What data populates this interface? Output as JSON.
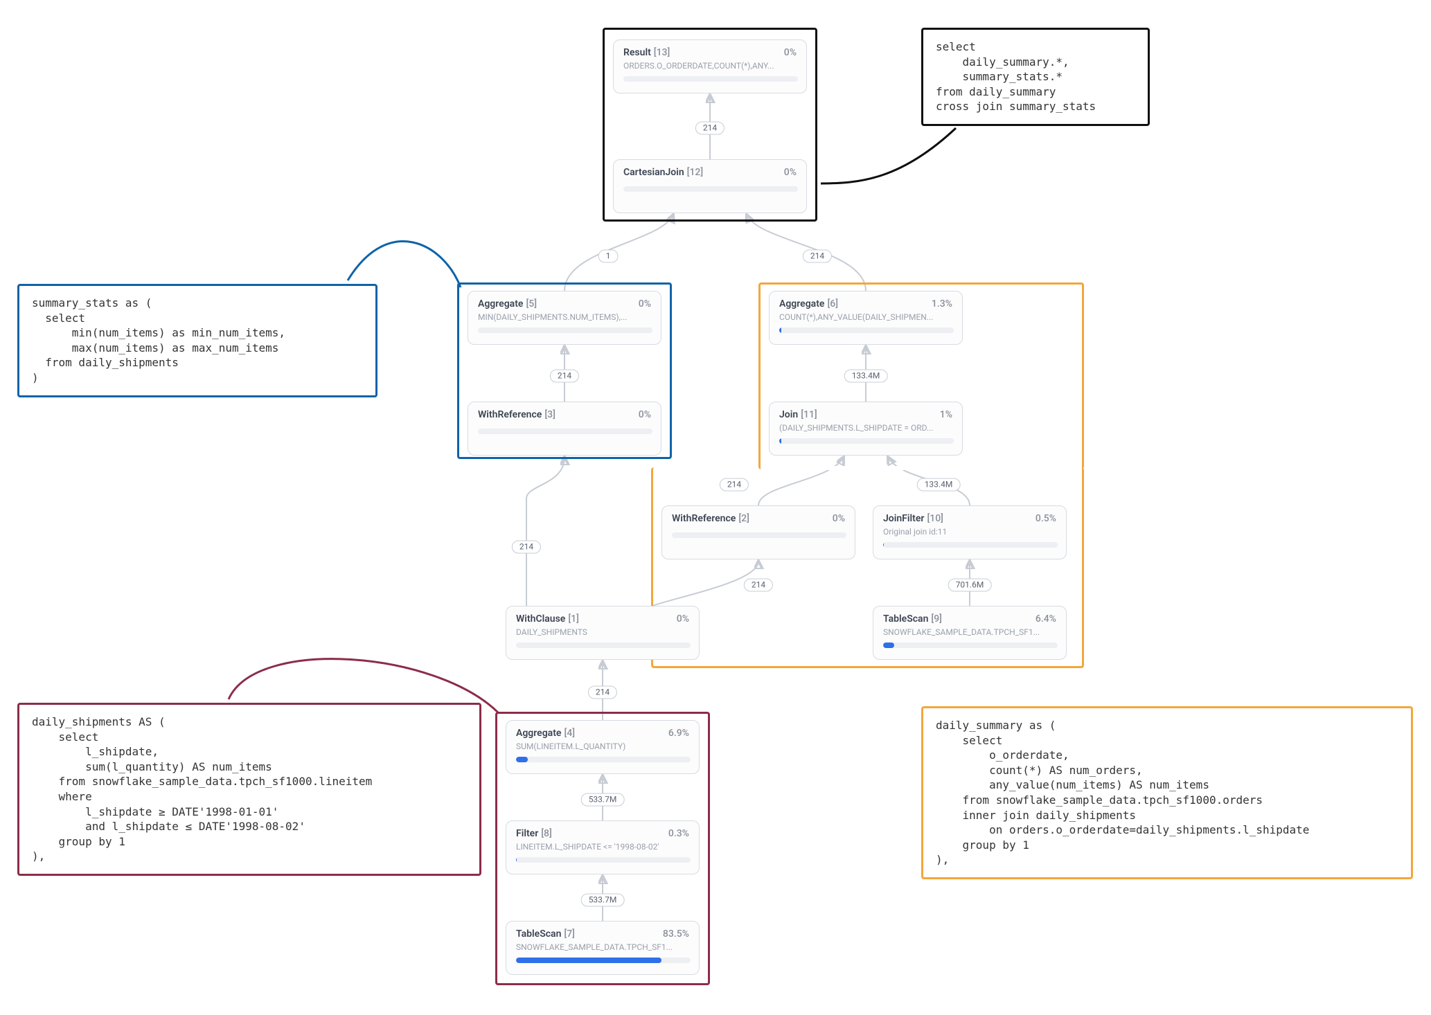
{
  "nodes": {
    "result": {
      "name": "Result",
      "id": "[13]",
      "pct": "0%",
      "sub": "ORDERS.O_ORDERDATE,COUNT(*),ANY...",
      "fill": 0
    },
    "cjoin": {
      "name": "CartesianJoin",
      "id": "[12]",
      "pct": "0%",
      "sub": "",
      "fill": 0
    },
    "agg5": {
      "name": "Aggregate",
      "id": "[5]",
      "pct": "0%",
      "sub": "MIN(DAILY_SHIPMENTS.NUM_ITEMS),...",
      "fill": 0
    },
    "withref3": {
      "name": "WithReference",
      "id": "[3]",
      "pct": "0%",
      "sub": "",
      "fill": 0
    },
    "agg6": {
      "name": "Aggregate",
      "id": "[6]",
      "pct": "1.3%",
      "sub": "COUNT(*),ANY_VALUE(DAILY_SHIPMEN...",
      "fill": 1.3
    },
    "join11": {
      "name": "Join",
      "id": "[11]",
      "pct": "1%",
      "sub": "(DAILY_SHIPMENTS.L_SHIPDATE = ORD...",
      "fill": 1
    },
    "withref2": {
      "name": "WithReference",
      "id": "[2]",
      "pct": "0%",
      "sub": "",
      "fill": 0
    },
    "joinfilt": {
      "name": "JoinFilter",
      "id": "[10]",
      "pct": "0.5%",
      "sub": "Original join id:11",
      "fill": 0.5
    },
    "withclause": {
      "name": "WithClause",
      "id": "[1]",
      "pct": "0%",
      "sub": "DAILY_SHIPMENTS",
      "fill": 0
    },
    "scan9": {
      "name": "TableScan",
      "id": "[9]",
      "pct": "6.4%",
      "sub": "SNOWFLAKE_SAMPLE_DATA.TPCH_SF1...",
      "fill": 6.4
    },
    "agg4": {
      "name": "Aggregate",
      "id": "[4]",
      "pct": "6.9%",
      "sub": "SUM(LINEITEM.L_QUANTITY)",
      "fill": 6.9
    },
    "filter8": {
      "name": "Filter",
      "id": "[8]",
      "pct": "0.3%",
      "sub": "LINEITEM.L_SHIPDATE <= '1998-08-02'",
      "fill": 0.3
    },
    "scan7": {
      "name": "TableScan",
      "id": "[7]",
      "pct": "83.5%",
      "sub": "SNOWFLAKE_SAMPLE_DATA.TPCH_SF1...",
      "fill": 83.5
    }
  },
  "pills": {
    "p1": "214",
    "p2": "1",
    "p3": "214",
    "p4": "214",
    "p5": "133.4M",
    "p6": "214",
    "p7": "133.4M",
    "p8": "214",
    "p9": "214",
    "p10": "701.6M",
    "p11": "214",
    "p12": "533.7M",
    "p13": "533.7M"
  },
  "code": {
    "top": "select\n    daily_summary.*,\n    summary_stats.*\nfrom daily_summary\ncross join summary_stats",
    "blue": "summary_stats as (\n  select\n      min(num_items) as min_num_items,\n      max(num_items) as max_num_items\n  from daily_shipments\n)",
    "maroon": "daily_shipments AS (\n    select\n        l_shipdate,\n        sum(l_quantity) AS num_items\n    from snowflake_sample_data.tpch_sf1000.lineitem\n    where\n        l_shipdate ≥ DATE'1998-01-01'\n        and l_shipdate ≤ DATE'1998-08-02'\n    group by 1\n),",
    "orange": "daily_summary as (\n    select\n        o_orderdate,\n        count(*) AS num_orders,\n        any_value(num_items) AS num_items\n    from snowflake_sample_data.tpch_sf1000.orders\n    inner join daily_shipments\n        on orders.o_orderdate=daily_shipments.l_shipdate\n    group by 1\n),"
  }
}
